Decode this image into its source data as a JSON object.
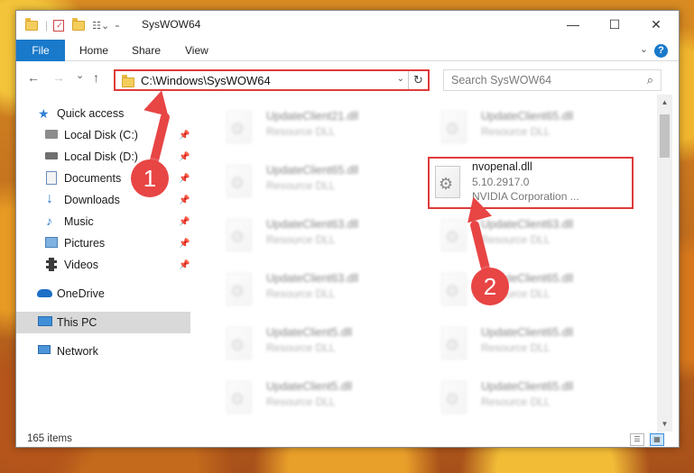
{
  "window": {
    "title": "SysWOW64",
    "minimize_glyph": "—",
    "maximize_glyph": "☐",
    "close_glyph": "✕"
  },
  "ribbon": {
    "tabs": [
      "File",
      "Home",
      "Share",
      "View"
    ],
    "help_glyph": "?"
  },
  "navigation": {
    "back_glyph": "←",
    "forward_glyph": "→",
    "recent_glyph": "⌄",
    "up_glyph": "↑",
    "address_path": "C:\\Windows\\SysWOW64",
    "address_dropdown_glyph": "⌄",
    "refresh_glyph": "↻",
    "search_placeholder": "Search SysWOW64",
    "search_glyph": "⌕"
  },
  "sidebar": {
    "items": [
      {
        "label": "Quick access",
        "icon": "star-icon"
      },
      {
        "label": "Local Disk (C:)",
        "icon": "drive-icon",
        "pinned": true
      },
      {
        "label": "Local Disk (D:)",
        "icon": "drive-icon",
        "pinned": true
      },
      {
        "label": "Documents",
        "icon": "documents-icon",
        "pinned": true
      },
      {
        "label": "Downloads",
        "icon": "download-arrow-icon",
        "pinned": true
      },
      {
        "label": "Music",
        "icon": "music-note-icon",
        "pinned": true
      },
      {
        "label": "Pictures",
        "icon": "pictures-icon",
        "pinned": true
      },
      {
        "label": "Videos",
        "icon": "film-icon",
        "pinned": true
      },
      {
        "label": "OneDrive",
        "icon": "cloud-icon"
      },
      {
        "label": "This PC",
        "icon": "monitor-icon",
        "selected": true
      },
      {
        "label": "Network",
        "icon": "network-icon"
      }
    ],
    "pin_glyph": "📌"
  },
  "files": {
    "items": [
      {
        "name": "UpdateClient21.dll",
        "desc": "Resource DLL"
      },
      {
        "name": "UpdateClient65.dll",
        "desc": "Resource DLL"
      },
      {
        "name": "UpdateClient65.dll",
        "desc": "Resource DLL"
      },
      {
        "name": "nvopenal.dll",
        "version": "5.10.2917.0",
        "company": "NVIDIA Corporation ...",
        "highlighted": true
      },
      {
        "name": "UpdateClient63.dll",
        "desc": "Resource DLL"
      },
      {
        "name": "UpdateClient63.dll",
        "desc": "Resource DLL"
      },
      {
        "name": "UpdateClient63.dll",
        "desc": "Resource DLL"
      },
      {
        "name": "UpdateClient65.dll",
        "desc": "Resource DLL"
      },
      {
        "name": "UpdateClient5.dll",
        "desc": "Resource DLL"
      },
      {
        "name": "UpdateClient65.dll",
        "desc": "Resource DLL"
      },
      {
        "name": "UpdateClient5.dll",
        "desc": "Resource DLL"
      },
      {
        "name": "UpdateClient65.dll",
        "desc": "Resource DLL"
      }
    ]
  },
  "status": {
    "item_count": "165 items"
  },
  "annotations": {
    "step1": "1",
    "step2": "2",
    "color": "#e84545"
  }
}
